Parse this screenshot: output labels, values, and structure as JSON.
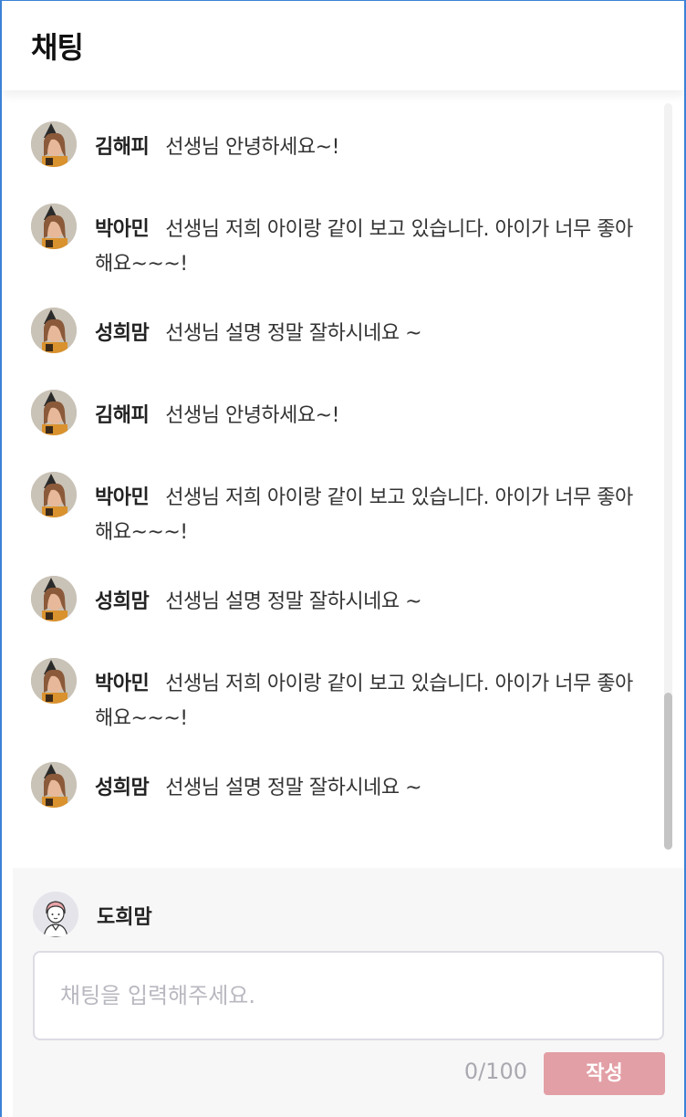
{
  "header": {
    "title": "채팅"
  },
  "messages": [
    {
      "name": "김해피",
      "text": "선생님 안녕하세요~!"
    },
    {
      "name": "박아민",
      "text": "선생님 저희 아이랑 같이 보고 있습니다. 아이가 너무 좋아해요~~~!"
    },
    {
      "name": "성희맘",
      "text": "선생님 설명 정말 잘하시네요 ~"
    },
    {
      "name": "김해피",
      "text": "선생님 안녕하세요~!"
    },
    {
      "name": "박아민",
      "text": "선생님 저희 아이랑 같이 보고 있습니다. 아이가 너무 좋아해요~~~!"
    },
    {
      "name": "성희맘",
      "text": "선생님 설명 정말 잘하시네요 ~"
    },
    {
      "name": "박아민",
      "text": "선생님 저희 아이랑 같이 보고 있습니다. 아이가 너무 좋아해요~~~!"
    },
    {
      "name": "성희맘",
      "text": "선생님 설명 정말 잘하시네요 ~"
    }
  ],
  "composer": {
    "user_name": "도희맘",
    "placeholder": "채팅을 입력해주세요.",
    "value": "",
    "counter": "0/100",
    "submit_label": "작성"
  },
  "colors": {
    "accent_button": "#e29fa5",
    "frame_border": "#3b82d6"
  },
  "icons": {
    "message_avatar": "user-photo-avatar",
    "composer_avatar": "user-illustration-avatar"
  }
}
